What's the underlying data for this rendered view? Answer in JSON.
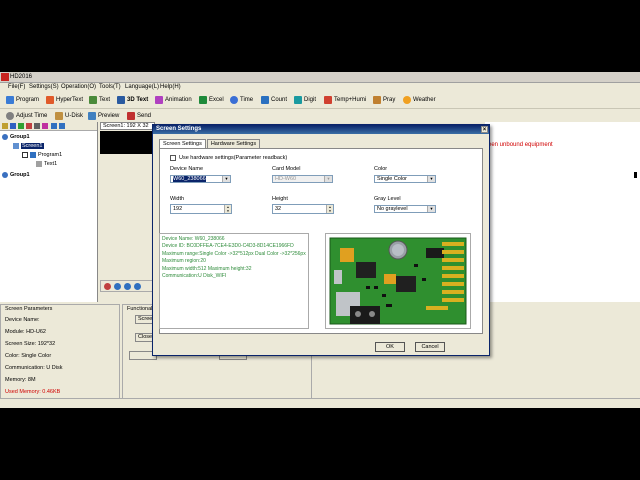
{
  "app": {
    "title": "HD2016",
    "menu": [
      "File(F)",
      "Settings(S)",
      "Operation(O)",
      "Tools(T)",
      "Language(L)",
      "Help(H)"
    ],
    "toolbar": [
      "Program",
      "HyperText",
      "Text",
      "3D Text",
      "Animation",
      "Excel",
      "Time",
      "Count",
      "Digit",
      "Temp+Humi",
      "Pray",
      "Weather"
    ],
    "toolbar2": [
      "Adjust Time",
      "U-Disk",
      "Preview",
      "Send"
    ]
  },
  "tree": {
    "group1": "Group1",
    "screen1": "Screen1",
    "program1": "Program1",
    "text1": "Text1",
    "group2": "Group1"
  },
  "preview": {
    "header": "Screen1: 192 X 32"
  },
  "log": {
    "message": "een unbound equipment"
  },
  "params": {
    "title": "Screen Parameters",
    "device_name": "Device Name:",
    "module": "Module: HD-U62",
    "size": "Screen Size:  192*32",
    "color": "Color: Single Color",
    "communication": "Communication: U Disk",
    "memory": "Memory: 8M",
    "used_memory": "Used Memory: 0.46KB"
  },
  "func": {
    "title": "Functional",
    "btn1": "Scree",
    "btn2": "Close"
  },
  "dialog": {
    "title": "Screen Settings",
    "tabs": [
      "Screen Settings",
      "Hardware Settings"
    ],
    "use_hardware": "Use hardware settings(Parameter readback)",
    "device_name_label": "Device Name",
    "device_name_value": "W60_238066",
    "card_model_label": "Card Model",
    "card_model_value": "HD-W60",
    "color_label": "Color",
    "color_value": "Single Color",
    "width_label": "Width",
    "width_value": "192",
    "height_label": "Height",
    "height_value": "32",
    "gray_label": "Gray Level",
    "gray_value": "No graylevel",
    "info": [
      "Device Name: W60_238066",
      "Device ID: BC0DFFEA-7CE4-E3D0-C4D3-8D14CE1966FD",
      "Maximum range:Single Color ->32*512px  Dual Color ->32*256px",
      "Maximum region:20",
      "Maximum width:512 Maximum height:32",
      "Communication:U Disk_WIFI"
    ],
    "ok": "OK",
    "cancel": "Cancel"
  },
  "colors": {
    "accent": "#0a246a",
    "info_text": "#2e8b3a",
    "error_text": "#d00000",
    "pcb_green": "#2f8f2f"
  }
}
